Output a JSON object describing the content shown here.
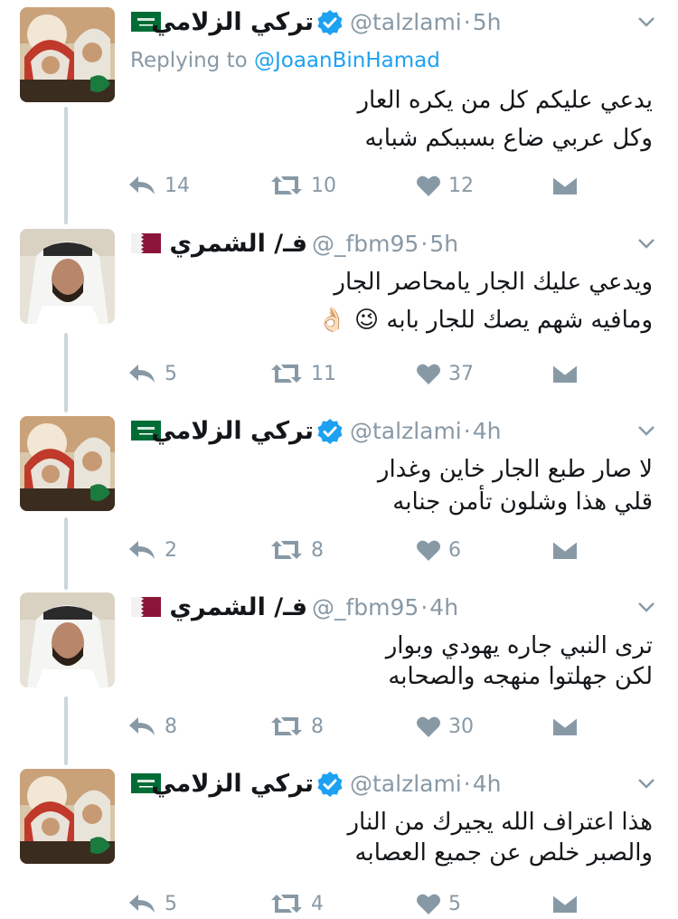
{
  "reply_context": {
    "prefix": "Replying to",
    "mention": "@JoaanBinHamad"
  },
  "tweets": [
    {
      "display_name": "تركي الزلامي",
      "handle": "@talzlami",
      "time": "5h",
      "verified": true,
      "flag": "saudi",
      "lines": [
        "يدعي عليكم كل من يكره العار",
        "وكل عربي ضاع بسببكم شبابه"
      ],
      "replies": "14",
      "retweets": "10",
      "likes": "12"
    },
    {
      "display_name": "فـ/ الشمري",
      "handle": "@_fbm95",
      "time": "5h",
      "verified": false,
      "flag": "qatar",
      "lines": [
        "ويدعي عليك الجار يامحاصر الجار",
        "ومافيه شهم يصك للجار بابه 😉 👌🏻"
      ],
      "replies": "5",
      "retweets": "11",
      "likes": "37"
    },
    {
      "display_name": "تركي الزلامي",
      "handle": "@talzlami",
      "time": "4h",
      "verified": true,
      "flag": "saudi",
      "lines": [
        "لا صار طبع الجار خاين وغدار",
        "قلي هذا وشلون تأمن جنابه"
      ],
      "replies": "2",
      "retweets": "8",
      "likes": "6"
    },
    {
      "display_name": "فـ/ الشمري",
      "handle": "@_fbm95",
      "time": "4h",
      "verified": false,
      "flag": "qatar",
      "lines": [
        "ترى النبي جاره يهودي وبوار",
        "لكن جهلتوا منهجه والصحابه"
      ],
      "replies": "8",
      "retweets": "8",
      "likes": "30"
    },
    {
      "display_name": "تركي الزلامي",
      "handle": "@talzlami",
      "time": "4h",
      "verified": true,
      "flag": "saudi",
      "lines": [
        "هذا اعتراف الله يجيرك من النار",
        "والصبر خلص عن جميع العصابه"
      ],
      "replies": "5",
      "retweets": "4",
      "likes": "5"
    }
  ],
  "colors": {
    "muted": "#8899a6",
    "link": "#1da1f2",
    "verified": "#1da1f2",
    "thread_line": "#ccd6dd",
    "saudi_green": "#006c35",
    "qatar_maroon": "#8a1538"
  },
  "icons": [
    "reply-icon",
    "retweet-icon",
    "like-icon",
    "direct-message-icon",
    "chevron-down-icon",
    "verified-badge-icon",
    "flag-icon"
  ]
}
